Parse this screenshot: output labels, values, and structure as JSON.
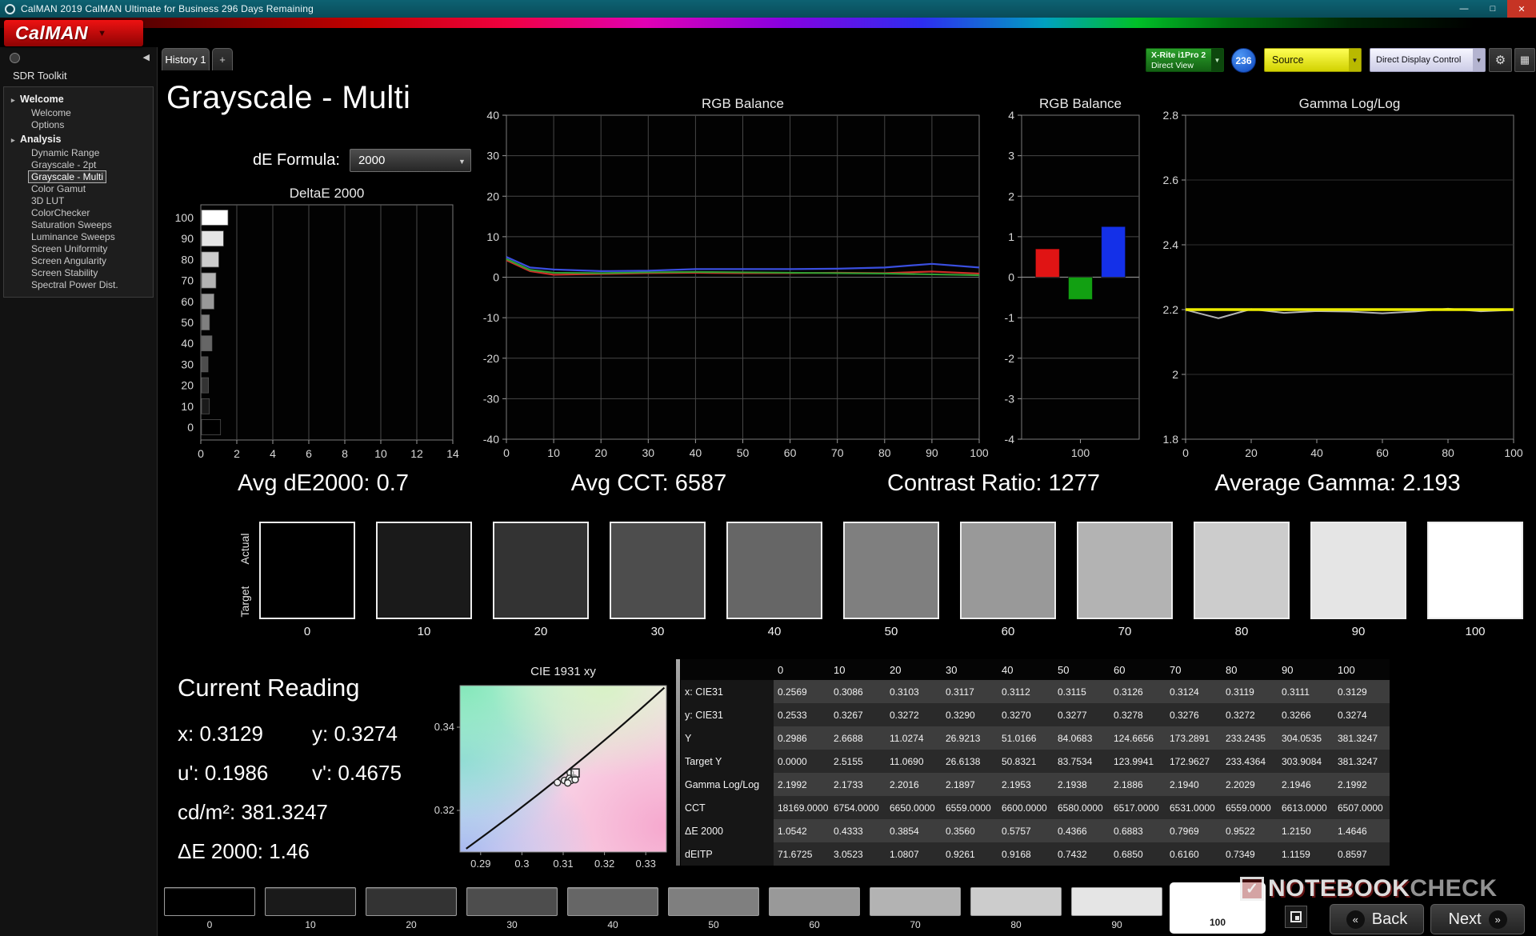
{
  "titlebar": {
    "title": "CalMAN 2019 CalMAN Ultimate for Business 296 Days Remaining"
  },
  "icons": {
    "minimize": "—",
    "maximize": "□",
    "close": "✕",
    "dropdown": "▼",
    "collapse": "◀",
    "gear": "⚙",
    "layout": "▦",
    "plus": "+",
    "back": "«",
    "next": "»",
    "check": "✓",
    "tree_arrow": "▸"
  },
  "brand": {
    "logo": "CalMAN"
  },
  "tabs": {
    "history": "History 1"
  },
  "topbar": {
    "meter_line1": "X-Rite i1Pro 2",
    "meter_line2": "Direct View",
    "badge": "236",
    "source": "Source",
    "display_control": "Direct Display Control"
  },
  "sidebar": {
    "toolkit_title": "SDR Toolkit",
    "selected": "Grayscale - Multi",
    "sections": [
      {
        "label": "Welcome",
        "items": [
          "Welcome",
          "Options"
        ]
      },
      {
        "label": "Analysis",
        "items": [
          "Dynamic Range",
          "Grayscale - 2pt",
          "Grayscale - Multi",
          "Color Gamut",
          "3D LUT",
          "ColorChecker",
          "Saturation Sweeps",
          "Luminance Sweeps",
          "Screen Uniformity",
          "Screen Angularity",
          "Screen Stability",
          "Spectral Power Dist."
        ]
      }
    ]
  },
  "page": {
    "title": "Grayscale - Multi",
    "de_formula_label": "dE Formula:",
    "de_formula_value": "2000"
  },
  "stats": [
    {
      "label": "Avg dE2000:",
      "value": "0.7"
    },
    {
      "label": "Avg CCT:",
      "value": "6587"
    },
    {
      "label": "Contrast Ratio:",
      "value": "1277"
    },
    {
      "label": "Average Gamma:",
      "value": "2.193"
    }
  ],
  "grayscale": {
    "row_labels": [
      "Actual",
      "Target"
    ],
    "levels": [
      "0",
      "10",
      "20",
      "30",
      "40",
      "50",
      "60",
      "70",
      "80",
      "90",
      "100"
    ],
    "selected_pattern": "100"
  },
  "current_reading": {
    "title": "Current Reading",
    "x": "x: 0.3129",
    "y": "y: 0.3274",
    "u": "u': 0.1986",
    "v": "v': 0.4675",
    "luminance": "cd/m²: 381.3247",
    "delta_e": "ΔE 2000: 1.46"
  },
  "table": {
    "columns": [
      "0",
      "10",
      "20",
      "30",
      "40",
      "50",
      "60",
      "70",
      "80",
      "90",
      "100"
    ],
    "rows": [
      {
        "label": "x: CIE31",
        "values": [
          "0.2569",
          "0.3086",
          "0.3103",
          "0.3117",
          "0.3112",
          "0.3115",
          "0.3126",
          "0.3124",
          "0.3119",
          "0.3111",
          "0.3129"
        ]
      },
      {
        "label": "y: CIE31",
        "values": [
          "0.2533",
          "0.3267",
          "0.3272",
          "0.3290",
          "0.3270",
          "0.3277",
          "0.3278",
          "0.3276",
          "0.3272",
          "0.3266",
          "0.3274"
        ]
      },
      {
        "label": "Y",
        "values": [
          "0.2986",
          "2.6688",
          "11.0274",
          "26.9213",
          "51.0166",
          "84.0683",
          "124.6656",
          "173.2891",
          "233.2435",
          "304.0535",
          "381.3247"
        ]
      },
      {
        "label": "Target Y",
        "values": [
          "0.0000",
          "2.5155",
          "11.0690",
          "26.6138",
          "50.8321",
          "83.7534",
          "123.9941",
          "172.9627",
          "233.4364",
          "303.9084",
          "381.3247"
        ]
      },
      {
        "label": "Gamma Log/Log",
        "values": [
          "2.1992",
          "2.1733",
          "2.2016",
          "2.1897",
          "2.1953",
          "2.1938",
          "2.1886",
          "2.1940",
          "2.2029",
          "2.1946",
          "2.1992"
        ]
      },
      {
        "label": "CCT",
        "values": [
          "18169.0000",
          "6754.0000",
          "6650.0000",
          "6559.0000",
          "6600.0000",
          "6580.0000",
          "6517.0000",
          "6531.0000",
          "6559.0000",
          "6613.0000",
          "6507.0000"
        ]
      },
      {
        "label": "ΔE 2000",
        "values": [
          "1.0542",
          "0.4333",
          "0.3854",
          "0.3560",
          "0.5757",
          "0.4366",
          "0.6883",
          "0.7969",
          "0.9522",
          "1.2150",
          "1.4646"
        ]
      },
      {
        "label": "dEITP",
        "values": [
          "71.6725",
          "3.0523",
          "1.0807",
          "0.9261",
          "0.9168",
          "0.7432",
          "0.6850",
          "0.6160",
          "0.7349",
          "1.1159",
          "0.8597"
        ]
      }
    ]
  },
  "chart_data": [
    {
      "id": "deltae",
      "type": "bar",
      "orientation": "horizontal",
      "title": "DeltaE 2000",
      "categories": [
        0,
        10,
        20,
        30,
        40,
        50,
        60,
        70,
        80,
        90,
        100
      ],
      "values": [
        1.0542,
        0.4333,
        0.3854,
        0.356,
        0.5757,
        0.4366,
        0.6883,
        0.7969,
        0.9522,
        1.215,
        1.4646
      ],
      "xlim": [
        0,
        14
      ],
      "xticks": [
        0,
        2,
        4,
        6,
        8,
        10,
        12,
        14
      ]
    },
    {
      "id": "rgb_balance_line",
      "type": "line",
      "title": "RGB Balance",
      "x": [
        0,
        5,
        10,
        20,
        30,
        40,
        50,
        60,
        70,
        80,
        90,
        100
      ],
      "series": [
        {
          "name": "Red",
          "color": "#cf2f28",
          "values": [
            4.2,
            1.5,
            0.6,
            0.8,
            1.0,
            1.1,
            1.0,
            1.0,
            1.1,
            1.0,
            1.4,
            0.9
          ]
        },
        {
          "name": "Green",
          "color": "#2f9e33",
          "values": [
            4.5,
            1.8,
            1.1,
            1.0,
            1.2,
            1.3,
            1.2,
            1.1,
            1.0,
            0.9,
            0.7,
            0.5
          ]
        },
        {
          "name": "Blue",
          "color": "#3a4fe0",
          "values": [
            5.0,
            2.4,
            1.9,
            1.5,
            1.6,
            2.0,
            2.0,
            2.0,
            2.1,
            2.4,
            3.3,
            2.4
          ]
        }
      ],
      "ylim": [
        -40,
        40
      ],
      "yticks": [
        40,
        30,
        20,
        10,
        0,
        -10,
        -20,
        -30,
        -40
      ],
      "xticks": [
        0,
        10,
        20,
        30,
        40,
        50,
        60,
        70,
        80,
        90,
        100
      ]
    },
    {
      "id": "rgb_balance_bars",
      "type": "bar",
      "title": "RGB Balance",
      "categories": [
        "Red",
        "Green",
        "Blue"
      ],
      "values": [
        0.7,
        -0.55,
        1.25
      ],
      "colors": [
        "#e01414",
        "#12a012",
        "#1430e8"
      ],
      "ylim": [
        -4,
        4
      ],
      "yticks": [
        4,
        3,
        2,
        1,
        0,
        -1,
        -2,
        -3,
        -4
      ],
      "xtick_label": "100"
    },
    {
      "id": "gamma",
      "type": "line",
      "title": "Gamma Log/Log",
      "x": [
        0,
        10,
        20,
        30,
        40,
        50,
        60,
        70,
        80,
        90,
        100
      ],
      "series": [
        {
          "name": "Measured",
          "color": "#b4b4b4",
          "width": 2,
          "values": [
            2.1992,
            2.1733,
            2.2016,
            2.1897,
            2.1953,
            2.1938,
            2.1886,
            2.194,
            2.2029,
            2.1946,
            2.1992
          ]
        },
        {
          "name": "Target",
          "color": "#eded00",
          "width": 3.5,
          "values": [
            2.2,
            2.2,
            2.2,
            2.2,
            2.2,
            2.2,
            2.2,
            2.2,
            2.2,
            2.2,
            2.2
          ]
        }
      ],
      "ylim": [
        1.8,
        2.8
      ],
      "yticks": [
        "2.8",
        "2.6",
        "2.4",
        "2.2",
        "2",
        "1.8"
      ],
      "xticks": [
        0,
        20,
        40,
        60,
        80,
        100
      ]
    },
    {
      "id": "cie",
      "type": "scatter",
      "title": "CIE 1931 xy",
      "xlim": [
        0.285,
        0.335
      ],
      "ylim": [
        0.31,
        0.35
      ],
      "xticks": [
        "0.29",
        "0.3",
        "0.31",
        "0.32",
        "0.33"
      ],
      "yticks": [
        "0.34",
        "0.32"
      ],
      "target": {
        "x": 0.3129,
        "y": 0.329
      },
      "points": [
        [
          0.3086,
          0.3267
        ],
        [
          0.3103,
          0.3272
        ],
        [
          0.3117,
          0.329
        ],
        [
          0.3112,
          0.327
        ],
        [
          0.3115,
          0.3277
        ],
        [
          0.3126,
          0.3278
        ],
        [
          0.3124,
          0.3276
        ],
        [
          0.3119,
          0.3272
        ],
        [
          0.3111,
          0.3266
        ],
        [
          0.3129,
          0.3274
        ]
      ]
    }
  ],
  "footer": {
    "back": "Back",
    "next": "Next"
  },
  "watermark": {
    "part1": "NOTEBOOK",
    "part2": "CHECK"
  }
}
